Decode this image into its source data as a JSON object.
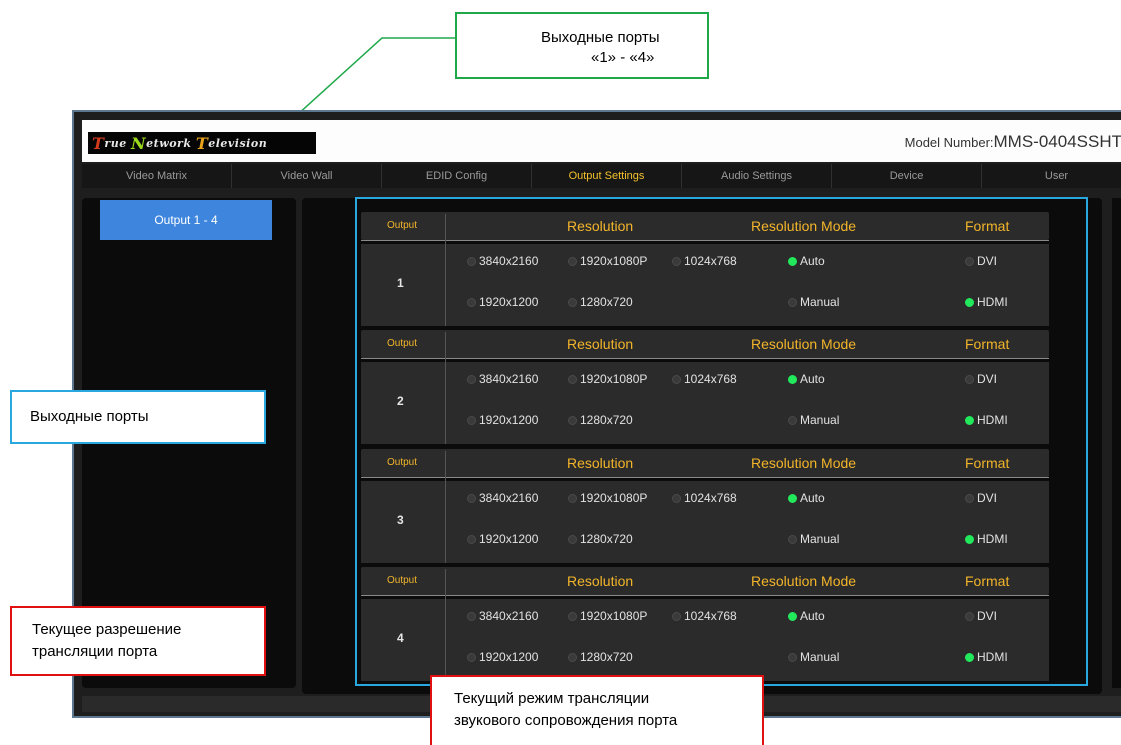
{
  "annotations": {
    "top": {
      "line1": "Выходные порты",
      "line2": "«1» - «4»"
    },
    "left": {
      "text": "Выходные порты"
    },
    "bottom_left": {
      "line1": "Текущее разрешение",
      "line2": "трансляции порта"
    },
    "bottom_center": {
      "line1": "Текущий режим трансляции",
      "line2": "звукового сопровождения порта"
    },
    "colors": {
      "green": "#1ea84a",
      "blue": "#29a8e0",
      "red": "#e01010"
    }
  },
  "header": {
    "logo": {
      "w1": "rue",
      "w2": "etwork",
      "w3": "elevision",
      "c1": "T",
      "c2": "N",
      "c3": "T"
    },
    "model_label": "Model Number:",
    "model_value": "MMS-0404SSHT"
  },
  "nav": {
    "tabs": [
      "Video Matrix",
      "Video Wall",
      "EDID Config",
      "Output Settings",
      "Audio Settings",
      "Device",
      "User"
    ],
    "active": "Output Settings"
  },
  "sidebar": {
    "button_label": "Output 1 - 4"
  },
  "table": {
    "col_output": "Output",
    "col_resolution": "Resolution",
    "col_mode": "Resolution Mode",
    "col_format": "Format",
    "resolutions_row1": [
      "3840x2160",
      "1920x1080P",
      "1024x768"
    ],
    "resolutions_row2": [
      "1920x1200",
      "1280x720"
    ],
    "modes": [
      "Auto",
      "Manual"
    ],
    "formats": [
      "DVI",
      "HDMI"
    ],
    "ports": [
      {
        "number": "1",
        "mode": "Auto",
        "format": "HDMI"
      },
      {
        "number": "2",
        "mode": "Auto",
        "format": "HDMI"
      },
      {
        "number": "3",
        "mode": "Auto",
        "format": "HDMI"
      },
      {
        "number": "4",
        "mode": "Auto",
        "format": "HDMI"
      }
    ]
  }
}
